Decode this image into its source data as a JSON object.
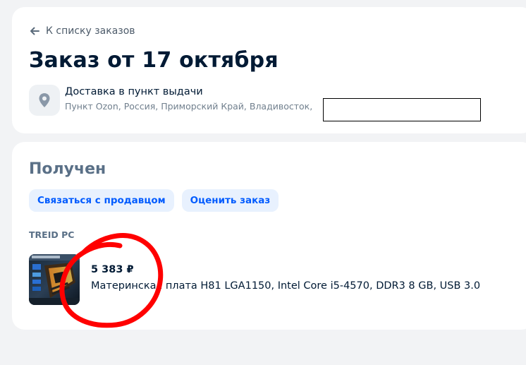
{
  "header": {
    "back_label": "К списку заказов",
    "title": "Заказ от 17 октября",
    "delivery_title": "Доставка в пункт выдачи",
    "delivery_address": "Пункт Ozon, Россия, Приморский Край, Владивосток,"
  },
  "order": {
    "status": "Получен",
    "contact_seller_label": "Связаться с продавцом",
    "rate_order_label": "Оценить заказ",
    "seller_name": "TREID PC",
    "item": {
      "price": "5 383 ₽",
      "name": "Материнская плата H81 LGA1150, Intel Core i5-4570, DDR3 8 GB, USB 3.0"
    }
  },
  "icons": {
    "back": "arrow-left-icon",
    "location": "map-pin-icon"
  },
  "colors": {
    "accent": "#005bff",
    "accent_bg": "#e8f1fe",
    "status": "#5a7087",
    "annotation": "#ff0000"
  }
}
